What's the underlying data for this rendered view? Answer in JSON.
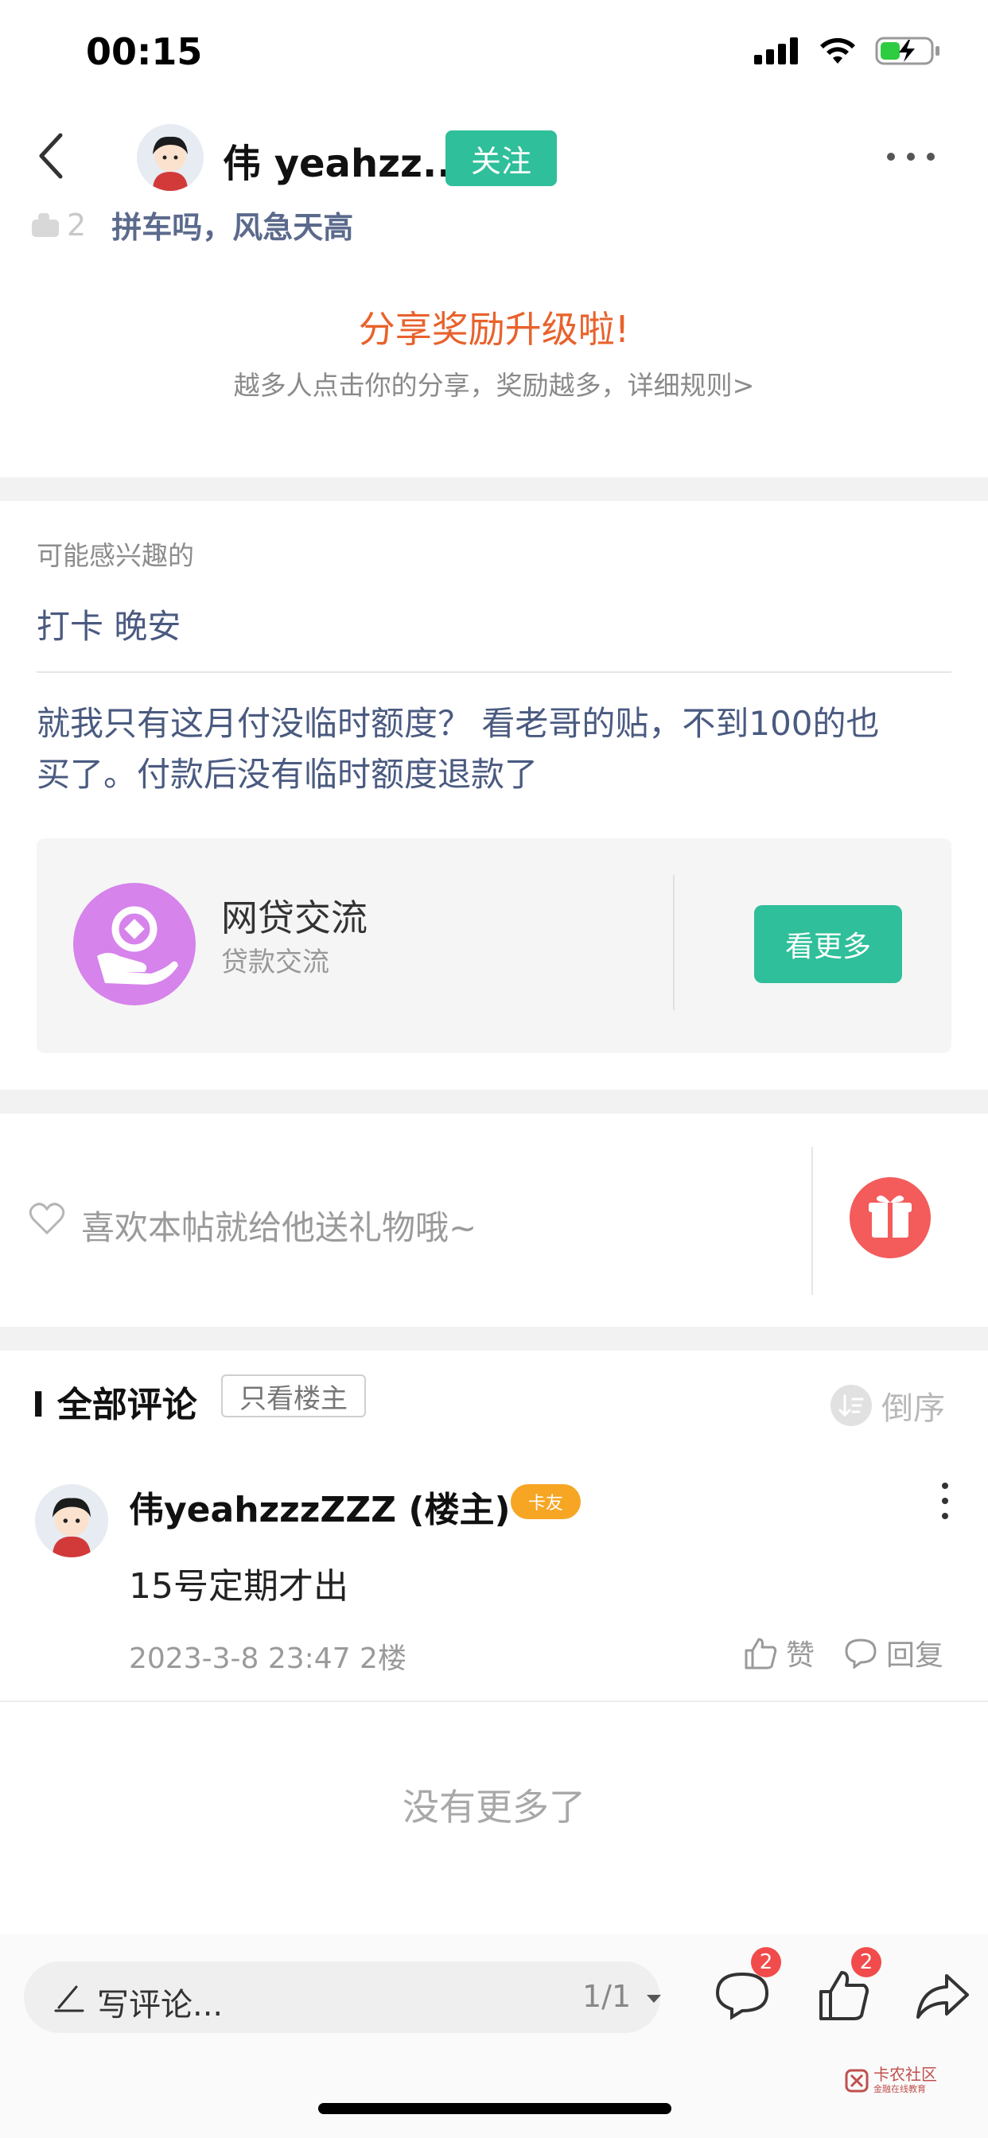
{
  "status_bar": {
    "time": "00:15"
  },
  "nav": {
    "username": "伟 yeahzz...",
    "follow_label": "关注"
  },
  "peek": {
    "count": "2",
    "text": "拼车吗，风急天高"
  },
  "share": {
    "title": "分享奖励升级啦!",
    "subtitle": "越多人点击你的分享，奖励越多，详细规则>"
  },
  "maybe": {
    "heading": "可能感兴趣的",
    "topic": "打卡 晚安",
    "post_line1": "就我只有这月付没临时额度？ 看老哥的贴，不到100的也",
    "post_line2": "买了。付款后没有临时额度退款了",
    "card": {
      "title": "网贷交流",
      "subtitle": "贷款交流",
      "button": "看更多"
    }
  },
  "gift": {
    "prompt": "喜欢本帖就给他送礼物哦~"
  },
  "comments": {
    "header": "I 全部评论",
    "only_op": "只看楼主",
    "sort_label": "倒序",
    "items": [
      {
        "name": "伟yeahzzzZZZ (楼主)",
        "badge": "卡友",
        "body": "15号定期才出",
        "meta": "2023-3-8 23:47  2楼",
        "like_label": "赞",
        "reply_label": "回复"
      }
    ],
    "end_text": "没有更多了"
  },
  "bottom_bar": {
    "placeholder": "写评论...",
    "page": "1/1",
    "comment_count": "2",
    "like_count": "2"
  },
  "watermark": {
    "text": "卡农社区",
    "sub": "金融在线教育"
  },
  "colors": {
    "accent_green": "#2fbf9a",
    "share_orange": "#e8622c",
    "link_blue": "#4a5a80",
    "badge_red": "#f24b4b"
  }
}
